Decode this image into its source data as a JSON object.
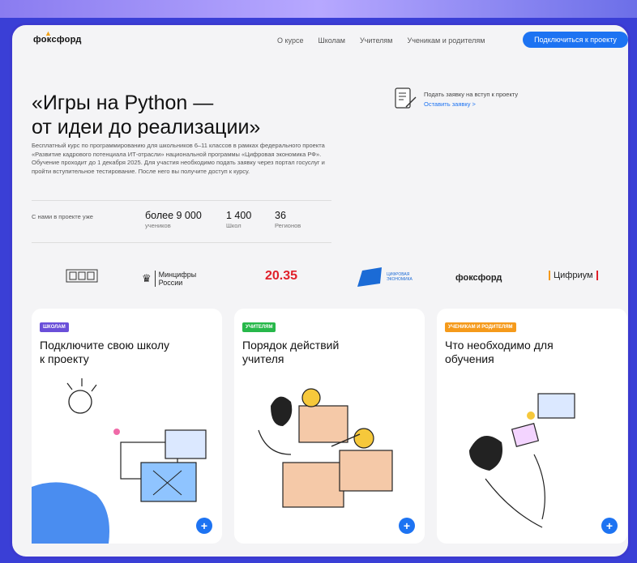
{
  "header": {
    "logo": "фоксфорд",
    "nav": [
      "О курсе",
      "Школам",
      "Учителям",
      "Ученикам и родителям"
    ],
    "cta": "Подключиться к проекту"
  },
  "hero": {
    "title": "«Игры на Python —\nот идеи до реализации»",
    "description": "Бесплатный курс по программированию для школьников 6–11 классов в рамках федерального проекта «Развитие кадрового потенциала ИТ-отрасли» национальной программы «Цифровая экономика РФ». Обучение проходит до 1 декабря 2025. Для участия необходимо подать заявку через портал госуслуг и пройти вступительное тестирование. После него вы получите доступ к курсу."
  },
  "stats": {
    "lead": "С нами в проекте уже",
    "items": [
      {
        "value": "более 9 000",
        "label": "учеников"
      },
      {
        "value": "1 400",
        "label": "Школ"
      },
      {
        "value": "36",
        "label": "Регионов"
      }
    ]
  },
  "request": {
    "title": "Подать заявку на вступ к проекту",
    "link": "Оставить заявку >"
  },
  "partners": {
    "mincifry": "Минцифры России",
    "p2035": "20.35",
    "digital_economy": "ЦИФРОВАЯ ЭКОНОМИКА",
    "foxford": "фоксфорд",
    "cifrium": "Цифриум"
  },
  "cards": [
    {
      "badge": "Школам",
      "title": "Подключите свою школу\nк проекту",
      "color": "#6a4fd9"
    },
    {
      "badge": "Учителям",
      "title": "Порядок действий\nучителя",
      "color": "#27b84a"
    },
    {
      "badge": "Ученикам и родителям",
      "title": "Что необходимо для\nобучения",
      "color": "#f59a1b"
    }
  ]
}
